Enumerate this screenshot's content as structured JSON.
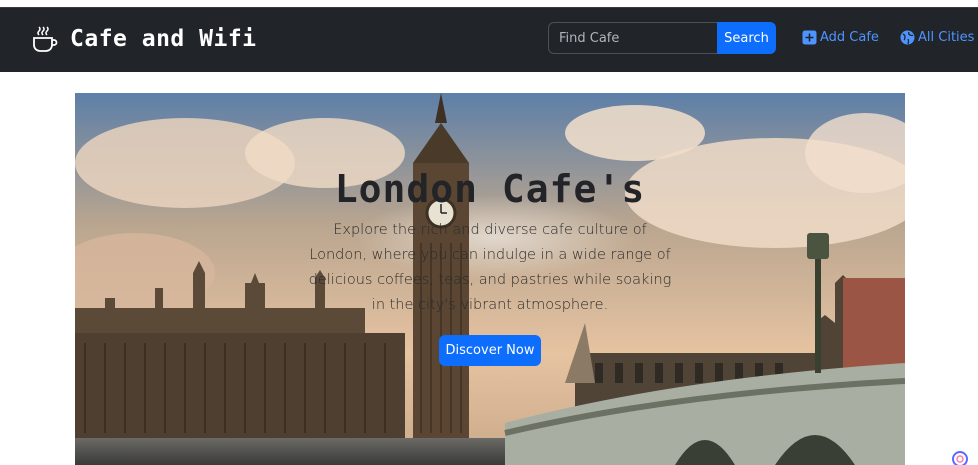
{
  "navbar": {
    "brand_icon": "coffee-cup-icon",
    "brand_name": "Cafe and Wifi",
    "search": {
      "placeholder": "Find Cafe",
      "value": "",
      "button_label": "Search"
    },
    "links": [
      {
        "label": "Add Cafe",
        "icon": "plus-square-icon"
      },
      {
        "label": "All Cities",
        "icon": "globe-icon"
      }
    ]
  },
  "hero": {
    "title": "London Cafe's",
    "description": "Explore the rich and diverse cafe culture of London, where you can indulge in a wide range of delicious coffees, teas, and pastries while soaking in the city's vibrant atmosphere.",
    "button_label": "Discover Now",
    "background": "london-big-ben-westminster-photo"
  },
  "colors": {
    "navbar_bg": "#212529",
    "primary": "#0d6efd",
    "link": "#4d94ff",
    "title_text": "#222428"
  }
}
